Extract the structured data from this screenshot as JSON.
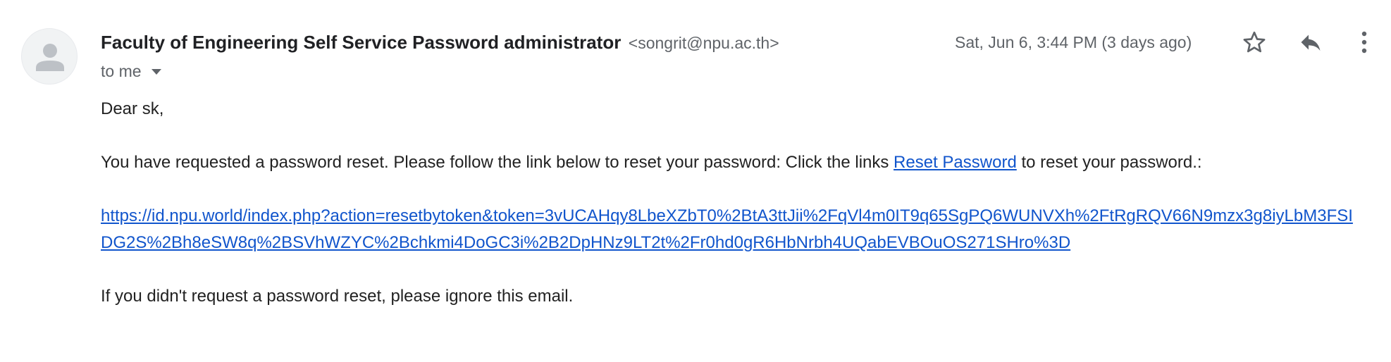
{
  "header": {
    "sender_name": "Faculty of Engineering Self Service Password administrator",
    "sender_email": "<songrit@npu.ac.th>",
    "recipient": "to me",
    "date": "Sat, Jun 6, 3:44 PM (3 days ago)",
    "icons": {
      "avatar": "person-icon",
      "star": "star-icon",
      "reply": "reply-icon",
      "more": "more-vert-icon",
      "recipient_menu": "caret-down-icon"
    }
  },
  "body": {
    "greeting": "Dear sk,",
    "intro_before": "You have requested a password reset. Please follow the link below to reset your password: Click the links ",
    "reset_link_text": "Reset Password",
    "intro_after": " to reset your password.:",
    "reset_url": "https://id.npu.world/index.php?action=resetbytoken&token=3vUCAHqy8LbeXZbT0%2BtA3ttJii%2FqVl4m0IT9q65SgPQ6WUNVXh%2FtRgRQV66N9mzx3g8iyLbM3FSIDG2S%2Bh8eSW8q%2BSVhWZYC%2Bchkmi4DoGC3i%2B2DpHNz9LT2t%2Fr0hd0gR6HbNrbh4UQabEVBOuOS271SHro%3D",
    "closing": "If you didn't request a password reset, please ignore this email."
  },
  "colors": {
    "link": "#1155cc",
    "secondary_text": "#5f6368",
    "primary_text": "#202124"
  }
}
